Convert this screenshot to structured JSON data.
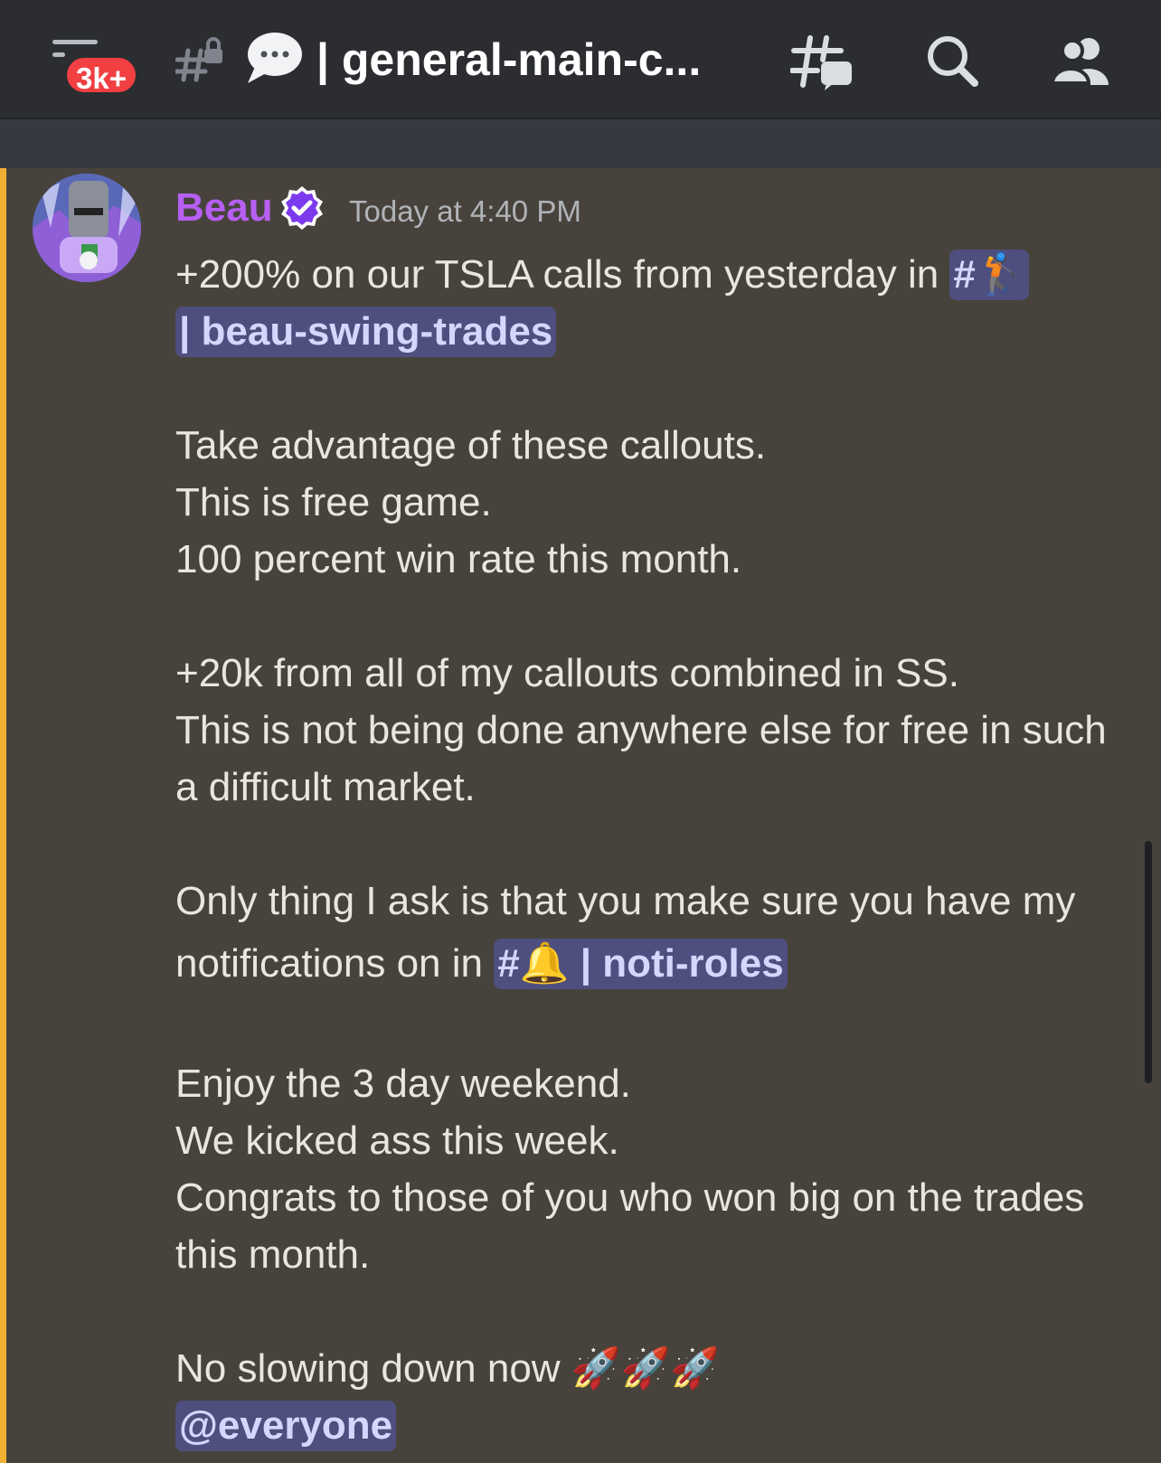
{
  "header": {
    "badge": "3k+",
    "channel_name": "| general-main-c..."
  },
  "message": {
    "author": "Beau",
    "timestamp": "Today at 4:40 PM",
    "line1_prefix": "+200% on our TSLA calls from yesterday in ",
    "mention1_hash": "#",
    "mention1_emoji": "🏌",
    "mention1_name": "| beau-swing-trades",
    "lines_a": [
      "Take advantage of these callouts.",
      "This is free game.",
      "100 percent win rate this month."
    ],
    "lines_b": [
      "+20k from all of my callouts combined in SS.",
      "This is not being done anywhere else for free in such",
      "a difficult market."
    ],
    "line_c": "Only thing I ask is that you make sure you have my",
    "line_d_prefix": "notifications on in ",
    "mention2_hash": "#",
    "mention2_emoji": "🔔",
    "mention2_name": " | noti-roles",
    "lines_e": [
      "Enjoy the 3 day weekend.",
      "We kicked ass this week.",
      "Congrats to those of you who won big on the trades",
      "this month."
    ],
    "line_f": "No slowing down now ",
    "line_f_emojis": "🚀🚀🚀",
    "mention3": "@everyone"
  },
  "colors": {
    "author": "#b65ff2",
    "mention_bg": "#4e4f7e",
    "accent": "#f0b132",
    "badge": "#f23f42"
  },
  "icons": [
    "hamburger-menu-icon",
    "locked-channel-icon",
    "speech-bubble-icon",
    "threads-icon",
    "search-icon",
    "members-icon",
    "verified-badge-icon"
  ]
}
